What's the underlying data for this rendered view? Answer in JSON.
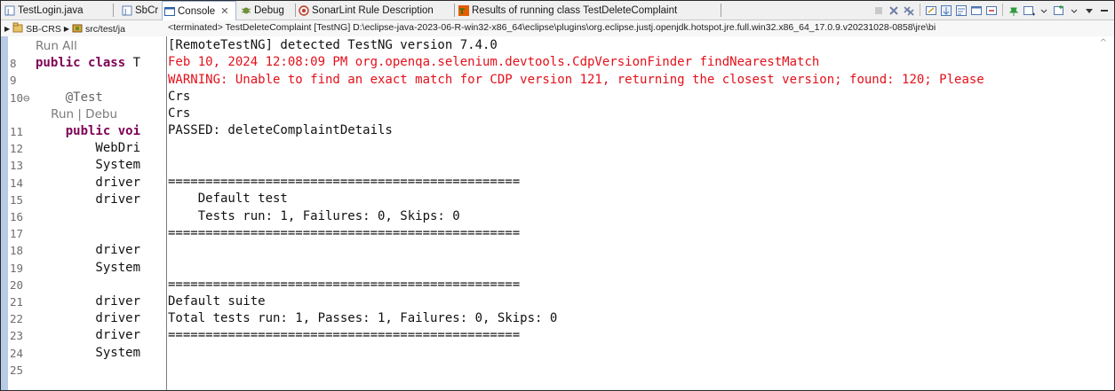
{
  "tabs": [
    {
      "label": "TestLogin.java",
      "icon": "java-file-icon"
    },
    {
      "label": "SbCr",
      "icon": "java-file-icon"
    },
    {
      "label": "Console",
      "icon": "console-icon",
      "active": true
    },
    {
      "label": "Debug",
      "icon": "debug-icon"
    },
    {
      "label": "SonarLint Rule Description",
      "icon": "sonarlint-icon"
    },
    {
      "label": "Results of running class TestDeleteComplaint",
      "icon": "testng-icon"
    }
  ],
  "breadcrumb": {
    "project": "SB-CRS",
    "path": "src/test/ja"
  },
  "console": {
    "header": "<terminated> TestDeleteComplaint [TestNG] D:\\eclipse-java-2023-06-R-win32-x86_64\\eclipse\\plugins\\org.eclipse.justj.openjdk.hotspot.jre.full.win32.x86_64_17.0.9.v20231028-0858\\jre\\bi",
    "lines": [
      {
        "text": "[RemoteTestNG] detected TestNG version 7.4.0",
        "error": false
      },
      {
        "text": "Feb 10, 2024 12:08:09 PM org.openqa.selenium.devtools.CdpVersionFinder findNearestMatch",
        "error": true
      },
      {
        "text": "WARNING: Unable to find an exact match for CDP version 121, returning the closest version; found: 120; Please",
        "error": true
      },
      {
        "text": "Crs",
        "error": false
      },
      {
        "text": "Crs",
        "error": false
      },
      {
        "text": "PASSED: deleteComplaintDetails",
        "error": false
      },
      {
        "text": "",
        "error": false
      },
      {
        "text": "",
        "error": false
      },
      {
        "text": "===============================================",
        "error": false
      },
      {
        "text": "    Default test",
        "error": false
      },
      {
        "text": "    Tests run: 1, Failures: 0, Skips: 0",
        "error": false
      },
      {
        "text": "===============================================",
        "error": false
      },
      {
        "text": "",
        "error": false
      },
      {
        "text": "",
        "error": false
      },
      {
        "text": "===============================================",
        "error": false
      },
      {
        "text": "Default suite",
        "error": false
      },
      {
        "text": "Total tests run: 1, Passes: 1, Failures: 0, Skips: 0",
        "error": false
      },
      {
        "text": "===============================================",
        "error": false
      }
    ]
  },
  "editor": {
    "lines": [
      {
        "num": "",
        "text": "Run All",
        "style": "lens"
      },
      {
        "num": "8",
        "text": "public class T",
        "style": "class"
      },
      {
        "num": "9",
        "text": "",
        "style": "plain"
      },
      {
        "num": "10⊖",
        "text": "    @Test",
        "style": "ann"
      },
      {
        "num": "",
        "text": "    Run | Debu",
        "style": "lens"
      },
      {
        "num": "11",
        "text": "    public voi",
        "style": "method"
      },
      {
        "num": "12",
        "text": "        WebDri",
        "style": "plain"
      },
      {
        "num": "13",
        "text": "        System",
        "style": "plain"
      },
      {
        "num": "14",
        "text": "        driver",
        "style": "plain"
      },
      {
        "num": "15",
        "text": "        driver",
        "style": "plain"
      },
      {
        "num": "16",
        "text": "",
        "style": "plain"
      },
      {
        "num": "17",
        "text": "",
        "style": "plain"
      },
      {
        "num": "18",
        "text": "        driver",
        "style": "plain"
      },
      {
        "num": "19",
        "text": "        System",
        "style": "plain"
      },
      {
        "num": "20",
        "text": "",
        "style": "plain"
      },
      {
        "num": "21",
        "text": "        driver",
        "style": "plain"
      },
      {
        "num": "22",
        "text": "        driver",
        "style": "plain"
      },
      {
        "num": "23",
        "text": "        driver",
        "style": "plain"
      },
      {
        "num": "24",
        "text": "        System",
        "style": "plain"
      },
      {
        "num": "25",
        "text": "",
        "style": "plain"
      }
    ]
  },
  "colors": {
    "error_text": "#e3101a",
    "keyword": "#7f0055",
    "ruler": "#b7cbe6"
  }
}
